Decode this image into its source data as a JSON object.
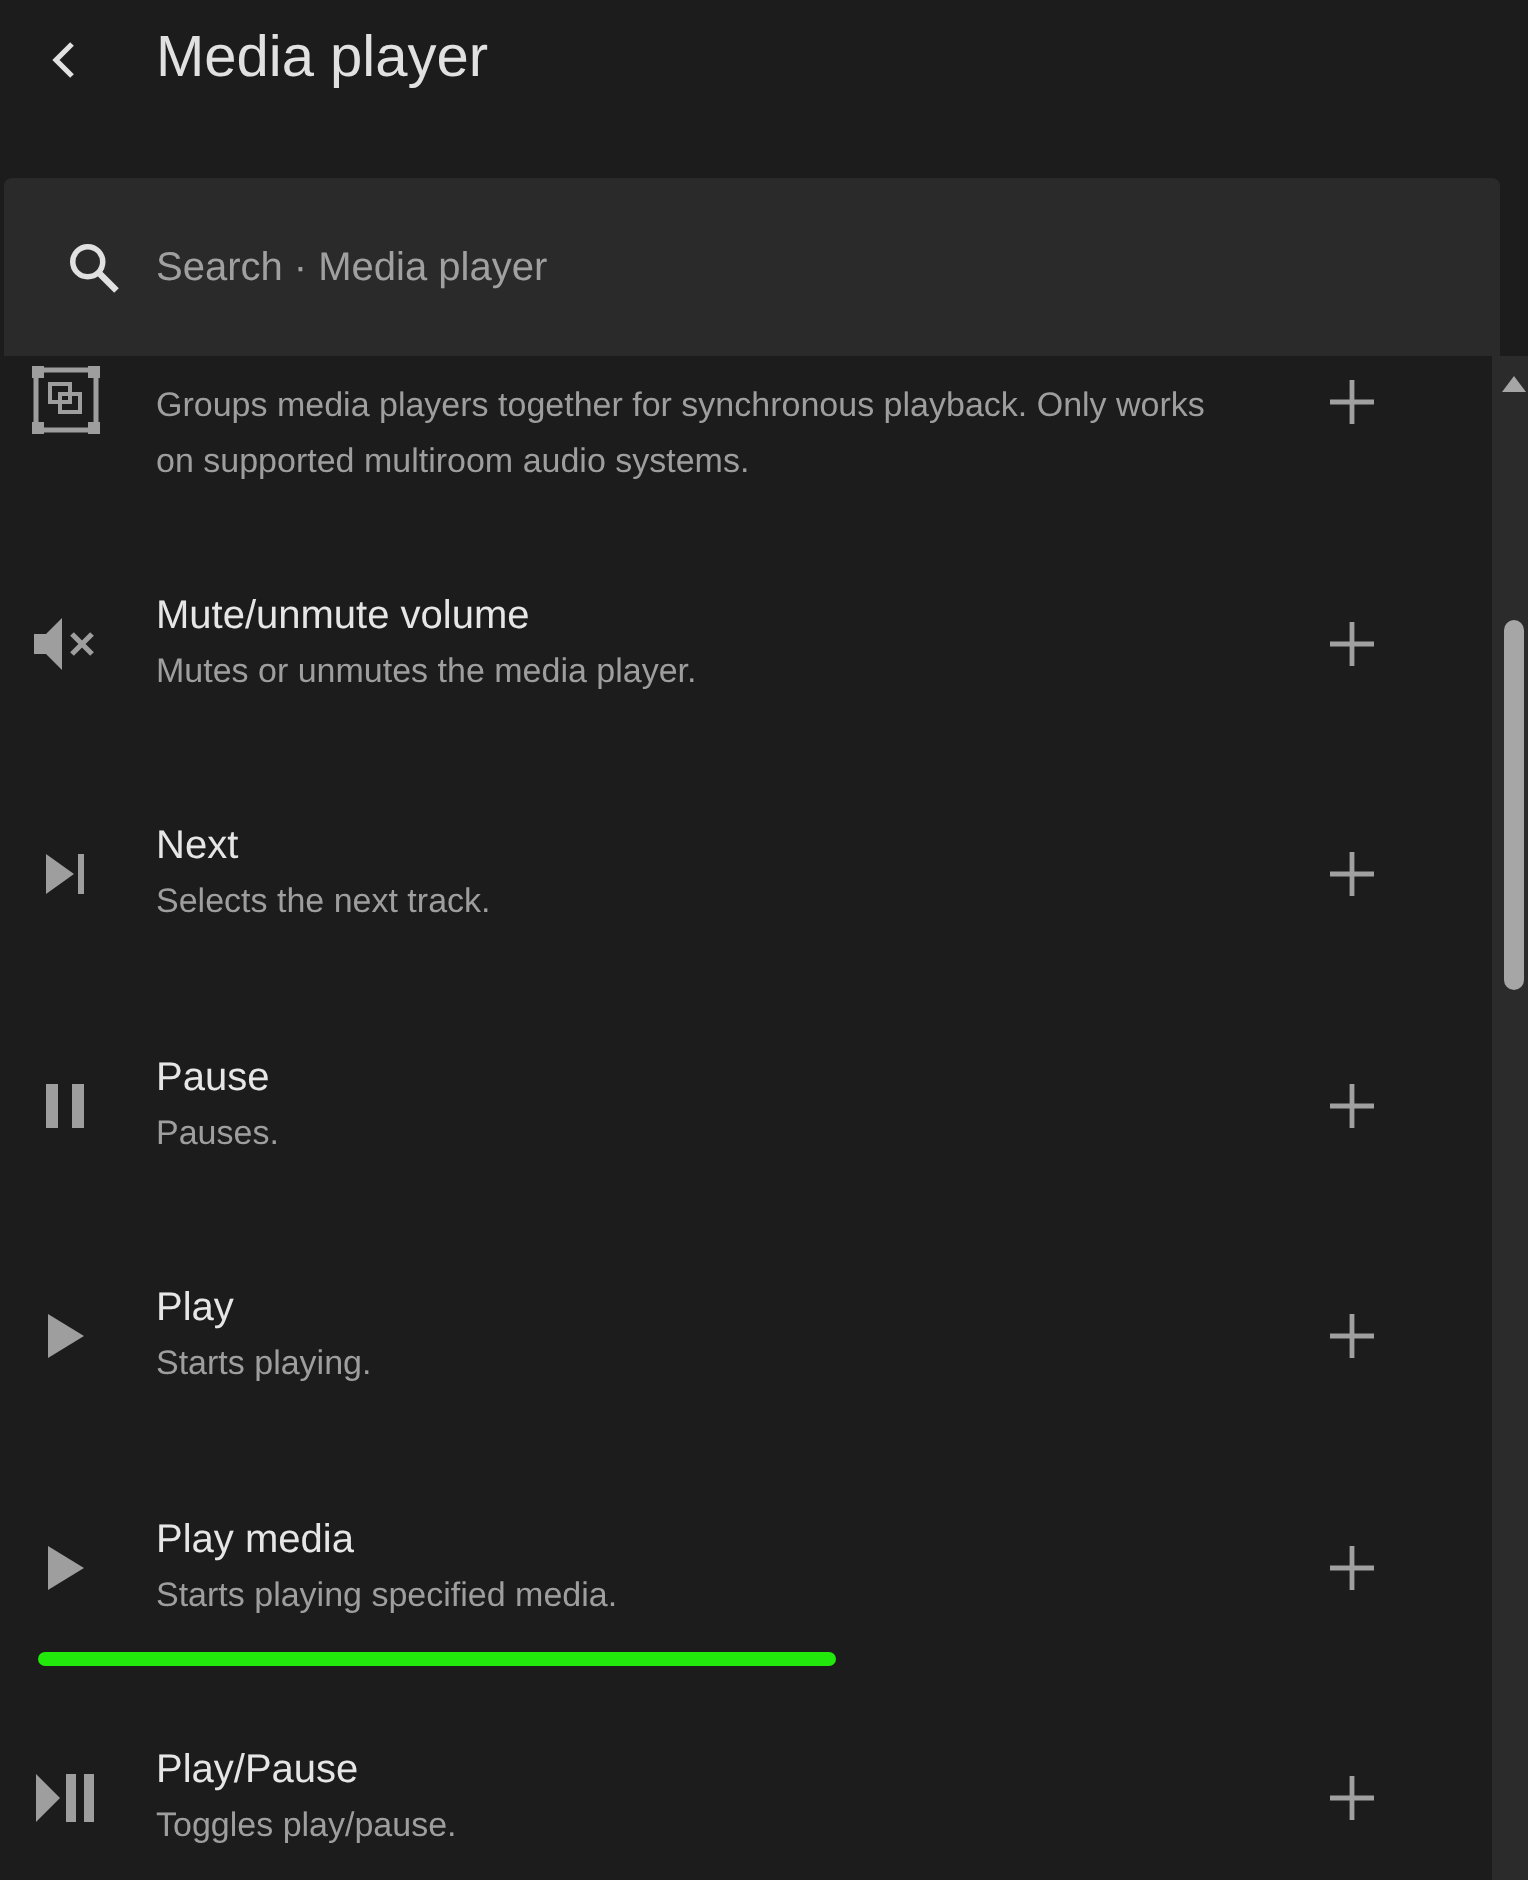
{
  "header": {
    "title": "Media player"
  },
  "search": {
    "placeholder": "Search · Media player"
  },
  "items": [
    {
      "kind": "join",
      "description": "Groups media players together for synchronous playback. Only works on supported multiroom audio systems."
    },
    {
      "kind": "mute",
      "title": "Mute/unmute volume",
      "description": "Mutes or unmutes the media player."
    },
    {
      "kind": "next",
      "title": "Next",
      "description": "Selects the next track."
    },
    {
      "kind": "pause",
      "title": "Pause",
      "description": "Pauses."
    },
    {
      "kind": "play",
      "title": "Play",
      "description": "Starts playing."
    },
    {
      "kind": "play",
      "title": "Play media",
      "description": "Starts playing specified media.",
      "underlined": true
    },
    {
      "kind": "playpause",
      "title": "Play/Pause",
      "description": "Toggles play/pause."
    }
  ]
}
